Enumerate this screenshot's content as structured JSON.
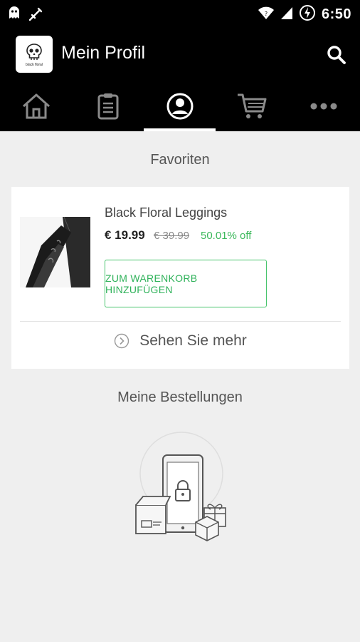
{
  "status_bar": {
    "time": "6:50",
    "icons": [
      "ghost-icon",
      "sword-icon",
      "wifi-icon",
      "signal-icon",
      "battery-charging-icon"
    ]
  },
  "header": {
    "logo_text": "Black Floral Leggings Logo",
    "title": "Mein Profil",
    "search_icon": "search-icon"
  },
  "nav": {
    "items": [
      {
        "icon": "home-icon",
        "active": false
      },
      {
        "icon": "clipboard-icon",
        "active": false
      },
      {
        "icon": "profile-icon",
        "active": true
      },
      {
        "icon": "cart-icon",
        "active": false
      },
      {
        "icon": "more-icon",
        "active": false
      }
    ]
  },
  "favorites": {
    "section_title": "Favoriten",
    "product": {
      "name": "Black Floral Leggings",
      "price": "€ 19.99",
      "old_price": "€ 39.99",
      "discount": "50.01% off",
      "add_to_cart_label": "ZUM WARENKORB HINZUFÜGEN"
    },
    "see_more_label": "Sehen Sie mehr"
  },
  "orders": {
    "section_title": "Meine Bestellungen",
    "empty_icon": "locked-phone-packages-icon"
  },
  "colors": {
    "accent_green": "#3bb85a",
    "bar_black": "#000000",
    "background": "#efefef"
  }
}
